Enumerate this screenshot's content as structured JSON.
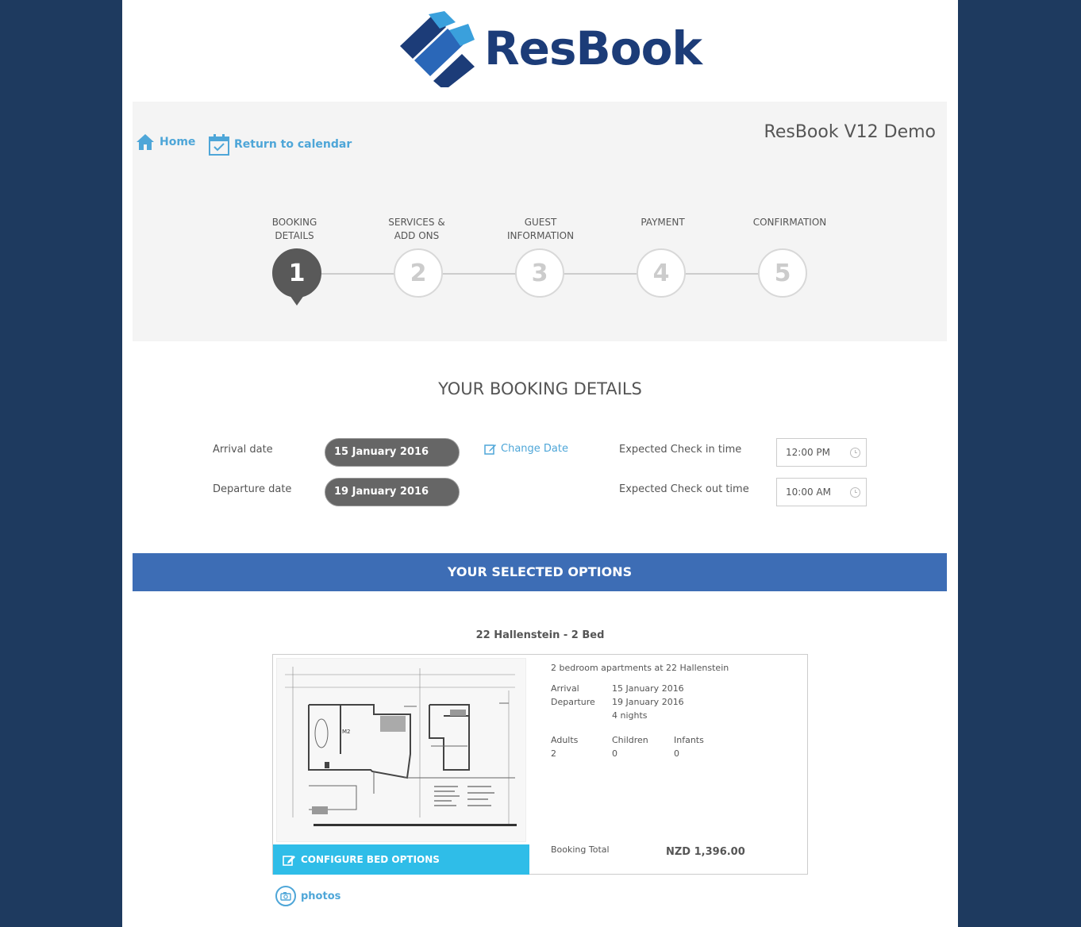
{
  "brand": {
    "name": "ResBook",
    "logo_color": "#1c3c78",
    "accent": "#4ea6d8"
  },
  "nav": {
    "home_label": "Home",
    "calendar_label": "Return to calendar"
  },
  "demo_title": "ResBook V12 Demo",
  "steps": [
    {
      "line1": "BOOKING",
      "line2": "DETAILS",
      "number": "1",
      "active": true
    },
    {
      "line1": "SERVICES &",
      "line2": "ADD ONS",
      "number": "2",
      "active": false
    },
    {
      "line1": "GUEST",
      "line2": "INFORMATION",
      "number": "3",
      "active": false
    },
    {
      "line1": "PAYMENT",
      "line2": "",
      "number": "4",
      "active": false
    },
    {
      "line1": "CONFIRMATION",
      "line2": "",
      "number": "5",
      "active": false
    }
  ],
  "booking": {
    "title": "YOUR BOOKING DETAILS",
    "arrival_label": "Arrival date",
    "arrival_value": "15 January 2016",
    "departure_label": "Departure date",
    "departure_value": "19 January 2016",
    "change_date_label": "Change Date",
    "checkin_label": "Expected Check in time",
    "checkin_value": "12:00 PM",
    "checkout_label": "Expected Check out time",
    "checkout_value": "10:00 AM"
  },
  "options": {
    "bar_title": "YOUR SELECTED OPTIONS",
    "room_title": "22 Hallenstein - 2 Bed",
    "description": "2 bedroom apartments at 22 Hallenstein",
    "arrival_label": "Arrival",
    "arrival_value": "15 January 2016",
    "departure_label": "Departure",
    "departure_value": "19 January 2016",
    "nights": "4 nights",
    "adults_label": "Adults",
    "adults_value": "2",
    "children_label": "Children",
    "children_value": "0",
    "infants_label": "Infants",
    "infants_value": "0",
    "total_label": "Booking Total",
    "total_value": "NZD 1,396.00",
    "configure_label": "CONFIGURE BED OPTIONS",
    "photos_label": "photos",
    "plan_room_label": "M2"
  }
}
